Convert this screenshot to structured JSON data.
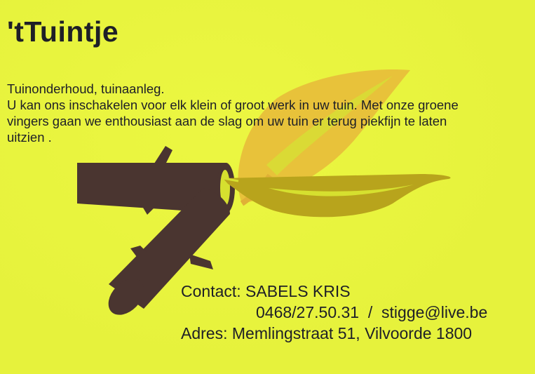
{
  "card": {
    "title": "'tTuintje",
    "intro_lines": [
      "Tuinonderhoud, tuinaanleg.",
      "U kan ons inschakelen voor elk klein of groot werk in uw tuin. Met onze groene",
      "vingers gaan we enthousiast aan de slag om uw tuin er terug piekfijn te laten",
      "uitzien ."
    ],
    "contact": {
      "label": "Contact:",
      "name": "SABELS KRIS",
      "phone": "0468/27.50.31",
      "separator": "/",
      "email": "stigge@live.be",
      "address_label": "Adres:",
      "address": "Memlingstraat 51, Vilvoorde 1800"
    },
    "logo": "branch-and-leaf-logo"
  },
  "colors": {
    "background": "#e6f23c",
    "text": "#1e1f27",
    "branch": "#4a3530",
    "leaf_gold": "#b8a41c",
    "leaf_orange": "#e8b93a",
    "leaf_light": "#d6e02f"
  }
}
